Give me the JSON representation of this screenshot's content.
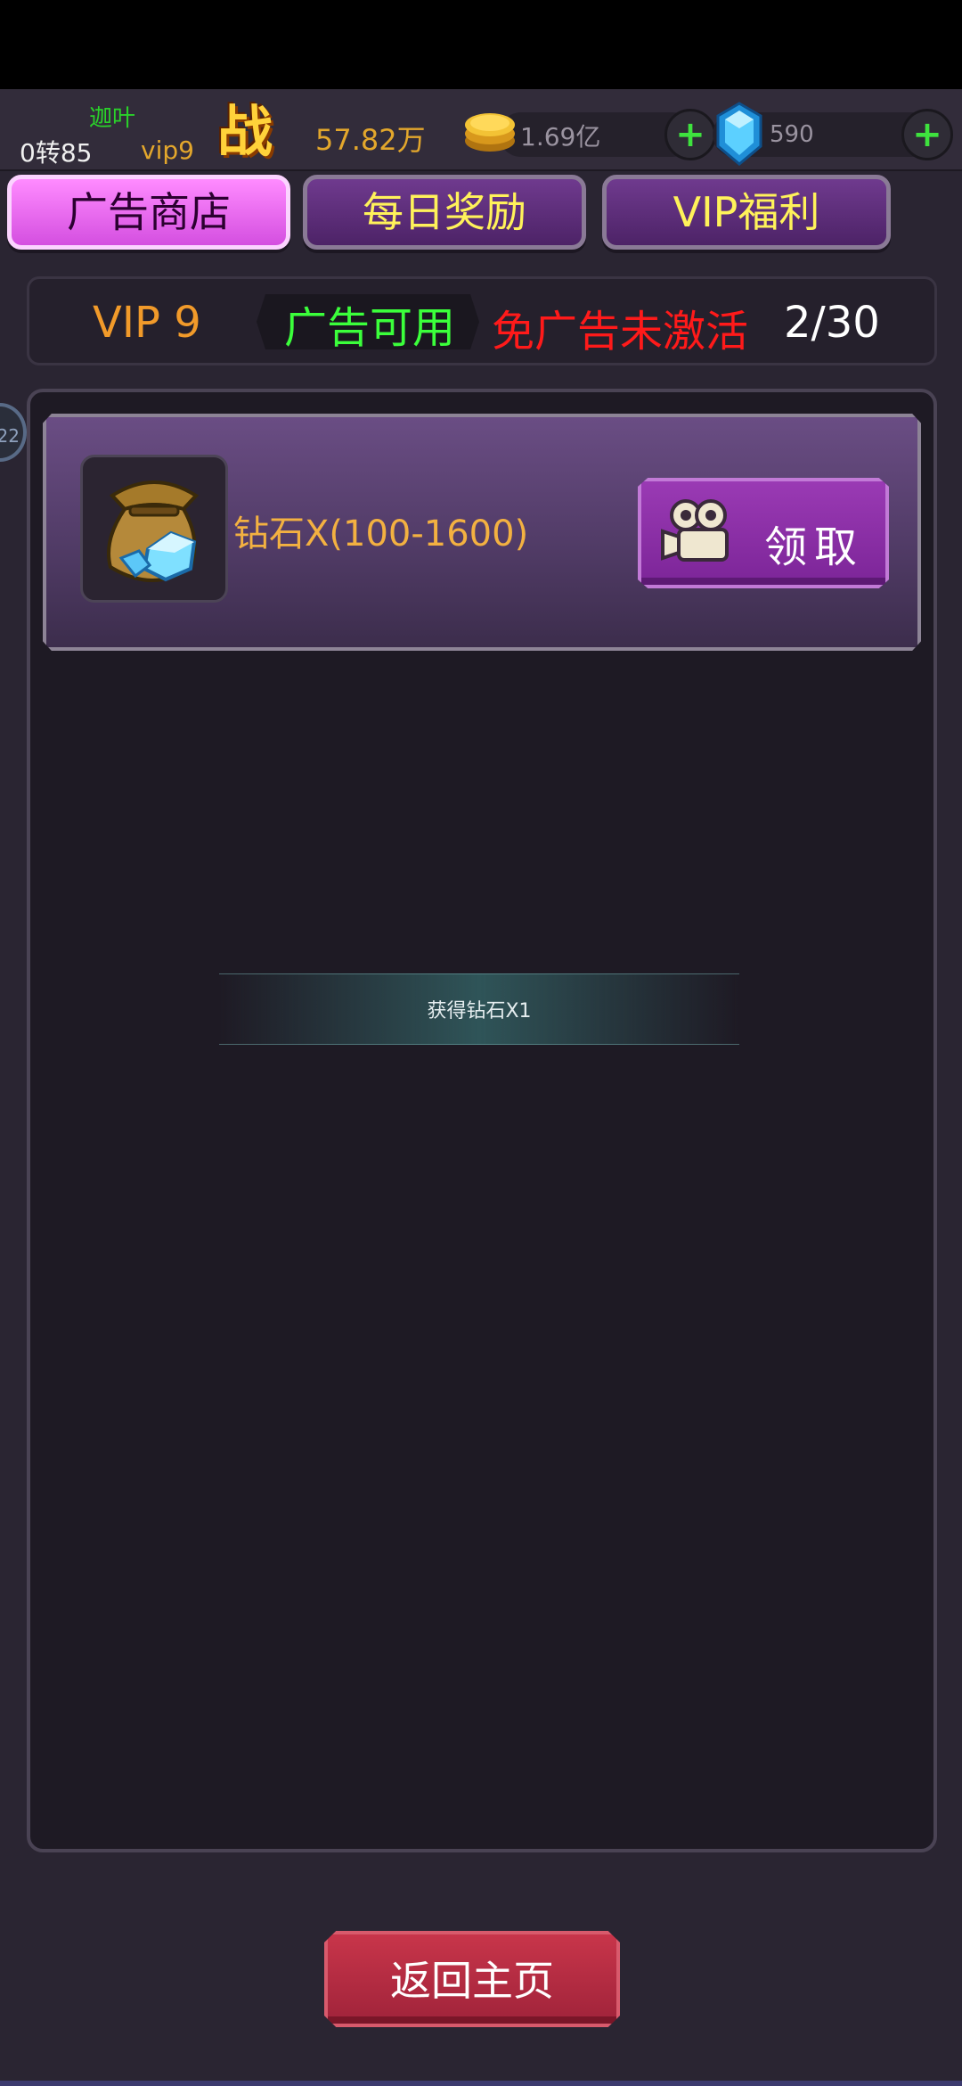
{
  "player": {
    "name": "迦叶",
    "rebirth": "0转85",
    "vip": "vip9",
    "battle_icon_char": "战",
    "power": "57.82万",
    "gold": "1.69亿",
    "diamond": "590"
  },
  "tabs": [
    {
      "label": "广告商店",
      "active": true
    },
    {
      "label": "每日奖励",
      "active": false
    },
    {
      "label": "VIP福利",
      "active": false
    }
  ],
  "info": {
    "vip": "VIP 9",
    "ad_status": "广告可用",
    "ad_free_status": "免广告未激活",
    "ad_count": "2/30"
  },
  "side_bubble": "22",
  "item": {
    "name": "钻石X(100-1600)",
    "claim_label": "领取"
  },
  "toast": "获得钻石X1",
  "back_label": "返回主页",
  "colors": {
    "accent_tab": "#d44fe0",
    "claim": "#8f30aa",
    "back": "#b42c43",
    "ad_ok": "#3bff3b",
    "ad_off": "#ff1a1a"
  },
  "icons": {
    "gold": "gold-coin-icon",
    "diamond": "diamond-icon",
    "camera": "video-camera-icon",
    "item": "diamond-bag-icon"
  }
}
